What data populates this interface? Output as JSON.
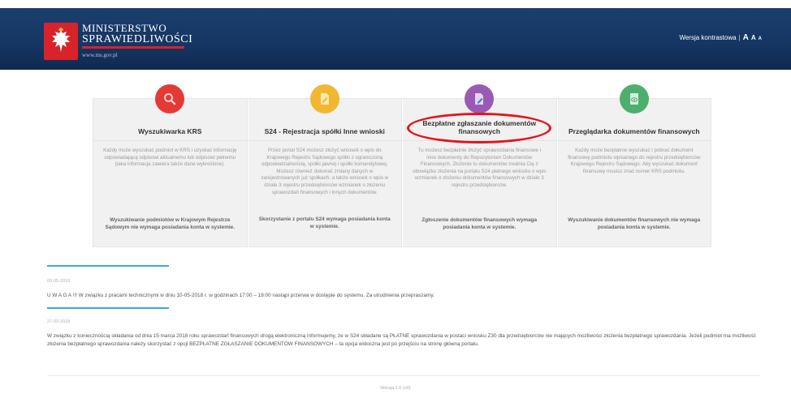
{
  "header": {
    "ministry_line1": "MINISTERSTWO",
    "ministry_line2": "SPRAWIEDLIWOŚCI",
    "url": "www.ms.gov.pl",
    "contrast_label": "Wersja kontrastowa",
    "separator": "|",
    "font_large": "A",
    "font_medium": "A",
    "font_small": "A"
  },
  "tiles": [
    {
      "icon": "search-icon",
      "icon_color": "#e53935",
      "title": "Wyszukiwarka KRS",
      "desc": "Każdy może wyszukać podmiot w KRS i uzyskać informację odpowiadającą odpisowi aktualnemu lub odpisowi pełnemu (taka informacja zawiera także dane wykreślone).",
      "foot": "Wyszukiwanie podmiotów w Krajowym Rejestrze Sądowym nie wymaga posiadania konta w systemie."
    },
    {
      "icon": "document-icon",
      "icon_color": "#f2b731",
      "title": "S24 - Rejestracja spółki Inne wnioski",
      "desc": "Przez portal S24 możesz złożyć wniosek o wpis do Krajowego Rejestru Sądowego spółki z ograniczoną odpowiedzialnością, spółki jawnej i spółki komandytowej. Możesz również dokonać zmiany danych w zarejestrowanych już spółkach, a także wniosek o wpis w dziale 3 rejestru przedsiębiorców wzmianek o złożeniu sprawozdań finansowych i innych dokumentów.",
      "foot": "Skorzystanie z portalu S24 wymaga posiadania konta w systemie."
    },
    {
      "icon": "document-edit-icon",
      "icon_color": "#9b59b6",
      "title": "Bezpłatne zgłaszanie dokumentów finansowych",
      "desc": "Tu możesz bezpłatnie złożyć sprawozdania finansowe i inne dokumenty do Repozytorium Dokumentów Finansowych. Złożenie tu dokumentów zwalnia Cię z obowiązku złożenia na portalu S24 płatnego wniosku o wpis wzmianek o złożeniu dokumentów finansowych w dziale 3 rejestru przedsiębiorców.",
      "foot": "Zgłoszenie dokumentów finansowych wymaga posiadania konta w systemie."
    },
    {
      "icon": "eye-document-icon",
      "icon_color": "#4caf6e",
      "title": "Przeglądarka dokumentów finansowych",
      "desc": "Każdy może bezpłatnie wyszukać i pobrać dokument finansowy podmiotu wpisanego do rejestru przedsiębiorców Krajowego Rejestru Sądowego. Aby wyszukać dokument finansowy musisz znać numer KRS podmiotu.",
      "foot": "Wyszukiwanie dokumentów finansowych nie wymaga posiadania konta w systemie."
    }
  ],
  "news": [
    {
      "date": "09-05-2018",
      "text": "U W A G A !!! W związku z pracami technicznymi w dniu 10-05-2018 r. w godzinach 17:00 – 18:00 nastąpi przerwa w dostępie do systemu. Za utrudnienia przepraszamy."
    },
    {
      "date": "27-03-2018",
      "text": "W związku z koniecznością składania od dnia 15 marca 2018 roku sprawozdań finansowych drogą elektroniczną informujemy, że w S24 składane są PŁATNE sprawozdania w postaci wniosku Z30 dla przedsiębiorców nie mających możliwości złożenia bezpłatnego sprawozdania. Jeżeli podmiot ma możliwość złożenia bezpłatnego sprawozdania należy skorzystać z opcji BEZPŁATNE ZGŁASZANIE DOKUMENTÓW FINANSOWYCH – ta opcja widoczna jest po przejściu na stronę główną portalu."
    }
  ],
  "footer": {
    "version": "Wersja 1.6 (n0)"
  },
  "colors": {
    "header": "#163664",
    "accent_red": "#d8232a",
    "news_line": "#3aa7e0",
    "highlight": "#e3141b"
  }
}
